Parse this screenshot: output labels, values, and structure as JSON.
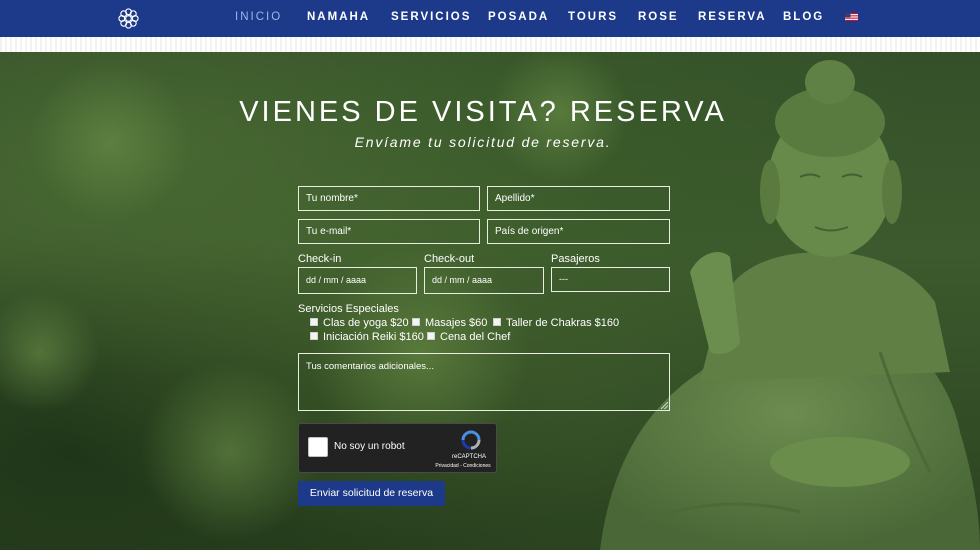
{
  "nav": {
    "items": [
      {
        "label": "INICIO",
        "active": true
      },
      {
        "label": "NAMAHA"
      },
      {
        "label": "SERVICIOS"
      },
      {
        "label": "POSADA"
      },
      {
        "label": "TOURS"
      },
      {
        "label": "ROSE"
      },
      {
        "label": "RESERVA"
      },
      {
        "label": "BLOG"
      }
    ],
    "logo_icon": "mandala-logo-icon",
    "language_icon": "us-flag-icon"
  },
  "hero": {
    "title": "VIENES DE VISITA? RESERVA",
    "subtitle": "Envíame tu solicitud de reserva."
  },
  "form": {
    "first_name_placeholder": "Tu nombre*",
    "last_name_placeholder": "Apellido*",
    "email_placeholder": "Tu e-mail*",
    "country_placeholder": "País de origen*",
    "checkin_label": "Check-in",
    "checkout_label": "Check-out",
    "guests_label": "Pasajeros",
    "checkin_value": "dd / mm / aaaa",
    "checkout_value": "dd / mm / aaaa",
    "guests_value": "---",
    "services_label": "Servicios Especiales",
    "services": [
      "Clas de yoga $20",
      "Masajes $60",
      "Taller de Chakras $160",
      "Iniciación Reiki $160",
      "Cena del Chef"
    ],
    "comments_placeholder": "Tus comentarios adicionales...",
    "recaptcha": {
      "label": "No soy un robot",
      "brand": "reCAPTCHA",
      "links": "Privacidad - Condiciones"
    },
    "submit_label": "Enviar solicitud de reserva"
  },
  "colors": {
    "nav_bg": "#1d3a8a",
    "nav_active": "#9fb4ef",
    "nav_underline": "#3d74d6",
    "button_bg": "#1d3a8a"
  }
}
